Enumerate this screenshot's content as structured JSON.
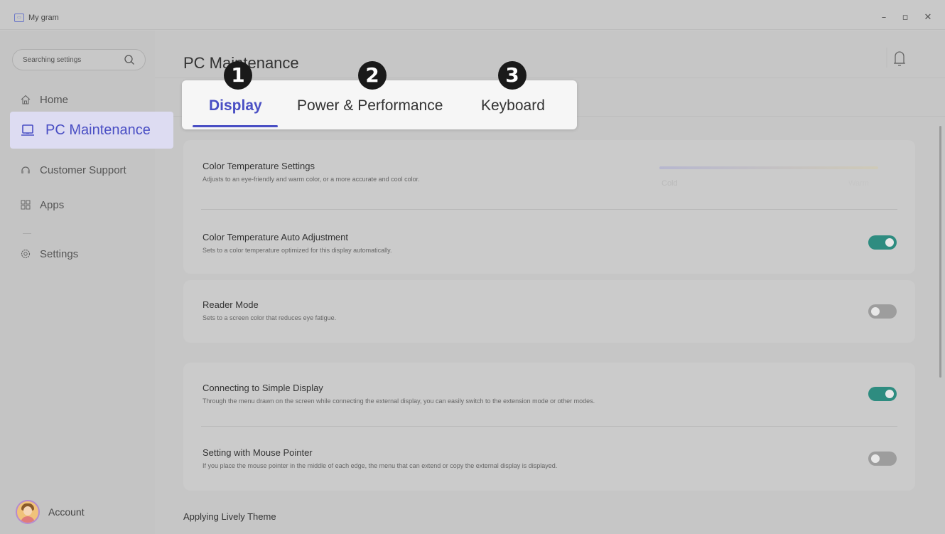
{
  "window": {
    "app_title": "My gram",
    "app_icon": "app-logo-icon",
    "controls": {
      "minimize": "–",
      "maximize": "▫",
      "close": "✕"
    }
  },
  "sidebar": {
    "search": {
      "placeholder": "Searching settings",
      "icon": "search-icon"
    },
    "items": [
      {
        "label": "Home",
        "icon": "home-icon"
      },
      {
        "label": "PC Maintenance",
        "icon": "laptop-icon",
        "active": true
      },
      {
        "label": "Customer Support",
        "icon": "headset-icon"
      },
      {
        "label": "Apps",
        "icon": "apps-grid-icon"
      },
      {
        "label": "Settings",
        "icon": "gear-icon"
      }
    ],
    "account": {
      "label": "Account",
      "icon": "avatar"
    }
  },
  "main": {
    "title": "PC Maintenance",
    "notification_icon": "bell-icon",
    "tabs": [
      {
        "label": "Display",
        "marker": "1",
        "active": true
      },
      {
        "label": "Power & Performance",
        "marker": "2"
      },
      {
        "label": "Keyboard",
        "marker": "3"
      }
    ],
    "cards": [
      {
        "settings": [
          {
            "title": "Color Temperature Settings",
            "desc": "Adjusts to an eye-friendly and warm color, or a more accurate and cool color.",
            "control": "slider",
            "slider_min_label": "Cold",
            "slider_max_label": "Warm"
          },
          {
            "title": "Color Temperature Auto Adjustment",
            "desc": "Sets to a color temperature optimized for this display automatically.",
            "control": "toggle",
            "on": true
          }
        ]
      },
      {
        "settings": [
          {
            "title": "Reader Mode",
            "desc": "Sets to a screen color that reduces eye fatigue.",
            "control": "toggle",
            "on": false
          }
        ]
      },
      {
        "settings": [
          {
            "title": "Connecting to Simple Display",
            "desc": "Through the menu drawn on the screen while connecting the external display, you can easily switch to the extension mode or other modes.",
            "control": "toggle",
            "on": true
          },
          {
            "title": "Setting with Mouse Pointer",
            "desc": "If you place the mouse pointer in the middle of each edge, the menu that can extend or copy the external display is displayed.",
            "control": "toggle",
            "on": false
          }
        ]
      }
    ],
    "next_section": "Applying Lively Theme"
  },
  "colors": {
    "accent": "#4a4fc4",
    "toggle_on": "#2e8c80",
    "toggle_off": "#9d9d9d",
    "active_nav_bg": "#dddcf2"
  }
}
